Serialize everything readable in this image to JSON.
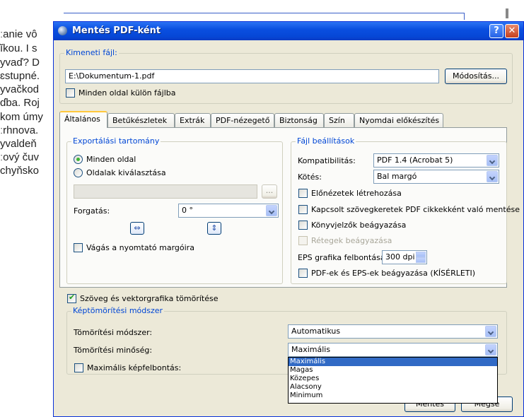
{
  "background_doc": {
    "lines": [
      "ːanie vô",
      "ĭkou. I s",
      "yvaď? D",
      "ɛstupné.",
      "yvačkod",
      "ɗba. Roj",
      "kom úmy",
      "ːrhnova.",
      "yvaldeň",
      "ːový čuv",
      "chyňsko"
    ]
  },
  "window": {
    "title": "Mentés PDF-ként",
    "help_label": "?",
    "close_label": "✕"
  },
  "output": {
    "group_label": "Kimeneti fájl:",
    "path": "E:\\Dokumentum-1.pdf",
    "modify_button": "Módosítás...",
    "separate_files_label": "Minden oldal külön fájlba"
  },
  "tabs": [
    "Általános",
    "Betűkészletek",
    "Extrák",
    "PDF-nézegető",
    "Biztonság",
    "Szín",
    "Nyomdai előkészítés"
  ],
  "export": {
    "group_label": "Exportálási tartomány",
    "all_pages": "Minden oldal",
    "select_pages": "Oldalak kiválasztása",
    "browse_label": "...",
    "rotation_label": "Forgatás:",
    "rotation_value": "0 °",
    "crop_label": "Vágás a nyomtató margóira"
  },
  "file_settings": {
    "group_label": "Fájl beállítások",
    "compat_label": "Kompatibilitás:",
    "compat_value": "PDF 1.4 (Acrobat 5)",
    "binding_label": "Kötés:",
    "binding_value": "Bal margó",
    "previews": "Előnézetek létrehozása",
    "linked_frames": "Kapcsolt szövegkeretek PDF cikkekként való mentése",
    "bookmarks": "Könyvjelzők beágyazása",
    "layers": "Rétegek beágyazása",
    "eps_res_label": "EPS grafika felbontása:",
    "eps_res_value": "300 dpi",
    "embed_pdf_eps": "PDF-ek és EPS-ek beágyazása (KÍSÉRLETI)"
  },
  "compress_text_label": "Szöveg és vektorgrafika tömörítése",
  "image_compress": {
    "group_label": "Képtömörítési módszer",
    "method_label": "Tömörítési módszer:",
    "method_value": "Automatikus",
    "quality_label": "Tömörítési minőség:",
    "quality_value": "Maximális",
    "max_res_label": "Maximális képfelbontás:",
    "options": [
      "Maximális",
      "Magas",
      "Közepes",
      "Alacsony",
      "Minimum"
    ]
  },
  "buttons": {
    "save": "Mentés",
    "cancel": "Mégse"
  }
}
